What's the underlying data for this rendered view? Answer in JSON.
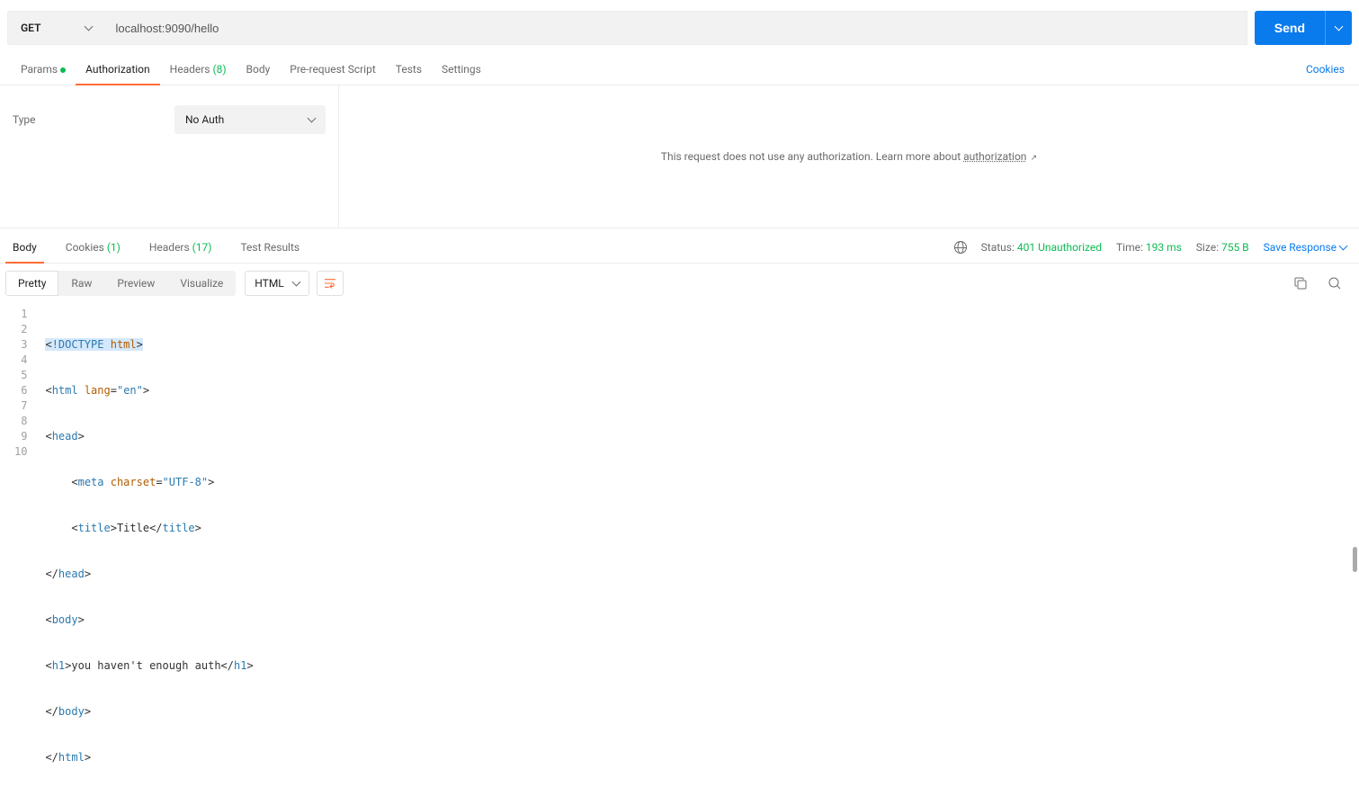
{
  "request": {
    "method": "GET",
    "url": "localhost:9090/hello",
    "send_label": "Send"
  },
  "tabs": {
    "params": "Params",
    "authorization": "Authorization",
    "headers": "Headers",
    "headers_count": "(8)",
    "body": "Body",
    "prerequest": "Pre-request Script",
    "tests": "Tests",
    "settings": "Settings",
    "cookies": "Cookies"
  },
  "auth": {
    "type_label": "Type",
    "selected": "No Auth",
    "message_prefix": "This request does not use any authorization. ",
    "message_learn": "Learn more about ",
    "link": "authorization"
  },
  "response_tabs": {
    "body": "Body",
    "cookies": "Cookies",
    "cookies_count": "(1)",
    "headers": "Headers",
    "headers_count": "(17)",
    "test_results": "Test Results"
  },
  "status": {
    "status_label": "Status:",
    "status_value": "401 Unauthorized",
    "time_label": "Time:",
    "time_value": "193 ms",
    "size_label": "Size:",
    "size_value": "755 B",
    "save": "Save Response"
  },
  "view": {
    "pretty": "Pretty",
    "raw": "Raw",
    "preview": "Preview",
    "visualize": "Visualize",
    "format": "HTML"
  },
  "code_lines": [
    "1",
    "2",
    "3",
    "4",
    "5",
    "6",
    "7",
    "8",
    "9",
    "10"
  ]
}
